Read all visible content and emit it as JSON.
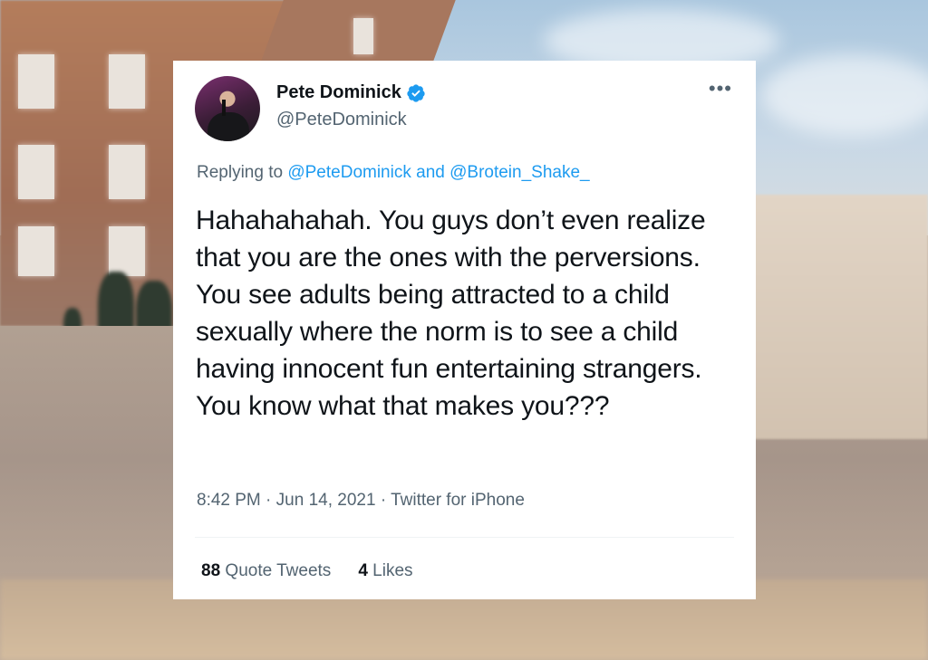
{
  "tweet": {
    "author": {
      "display_name": "Pete Dominick",
      "handle": "@PeteDominick",
      "verified": true
    },
    "reply": {
      "prefix": "Replying to",
      "mention_1": "@PeteDominick",
      "conjunction": "and",
      "mention_2": "@Brotein_Shake_"
    },
    "text": "Hahahahahah. You guys don’t even realize that you are the ones with the perversions. You see adults being attracted to a child sexually where the norm is to see a child having innocent fun entertaining strangers. You know what that makes you???",
    "time": "8:42 PM",
    "separator": "·",
    "date": "Jun 14, 2021",
    "source": "Twitter for iPhone",
    "quote_tweets_count": "88",
    "quote_tweets_label": "Quote Tweets",
    "likes_count": "4",
    "likes_label": "Likes",
    "more_icon": "more-horizontal-icon"
  },
  "colors": {
    "text_primary": "#0f1419",
    "text_secondary": "#536471",
    "link": "#1d9bf0",
    "verified": "#1d9bf0"
  }
}
